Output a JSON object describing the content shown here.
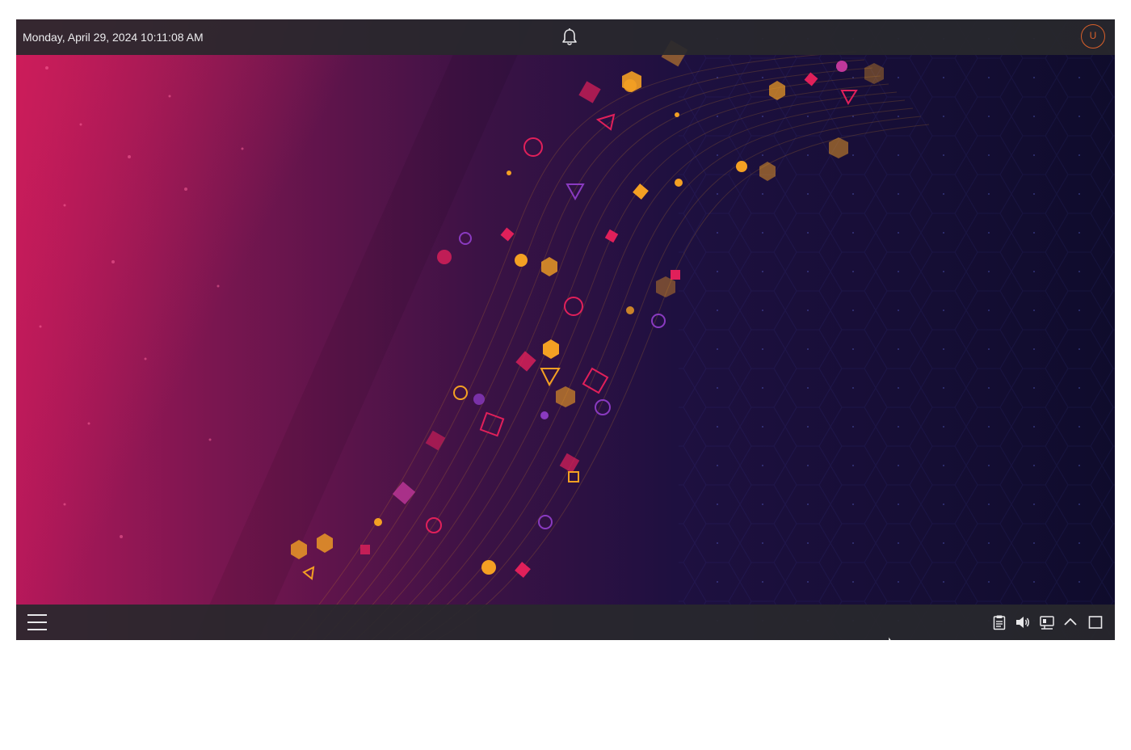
{
  "top_panel": {
    "clock_text": "Monday, April 29, 2024 10:11:08 AM",
    "notifications_icon": "bell-icon",
    "user_avatar_letter": "U",
    "avatar_color": "#d9602a"
  },
  "bottom_panel": {
    "launcher_icon": "hamburger-menu-icon",
    "tray_icons": [
      "clipboard-icon",
      "volume-icon",
      "network-icon",
      "chevron-up-icon",
      "show-desktop-icon"
    ]
  },
  "wallpaper": {
    "colors": {
      "left": "#c2185b",
      "mid": "#3a1247",
      "right": "#12103a",
      "accent_orange": "#f4a023",
      "accent_magenta": "#e0205a"
    }
  }
}
